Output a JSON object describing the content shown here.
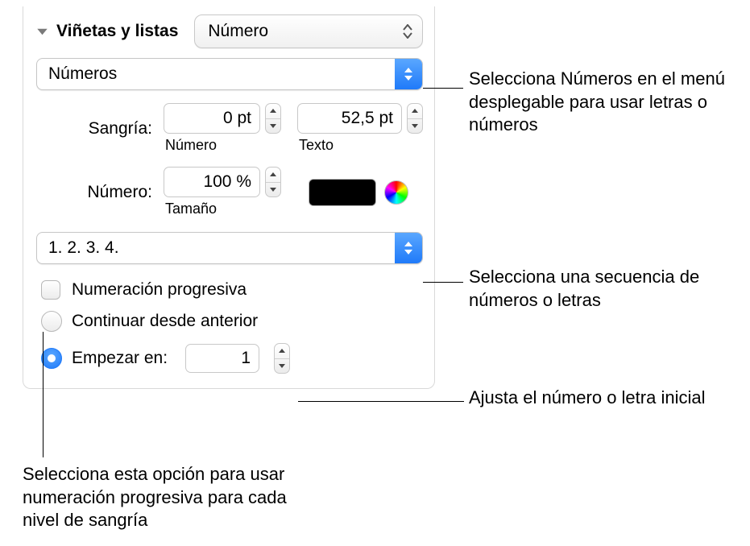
{
  "header": {
    "title": "Viñetas y listas",
    "type_value": "Número"
  },
  "numbers_popup": {
    "value": "Números"
  },
  "indent": {
    "label": "Sangría:",
    "number_value": "0 pt",
    "number_sublabel": "Número",
    "text_value": "52,5 pt",
    "text_sublabel": "Texto"
  },
  "number": {
    "label": "Número:",
    "size_value": "100 %",
    "size_sublabel": "Tamaño",
    "color": "#000000"
  },
  "sequence_popup": {
    "value": "1. 2. 3. 4."
  },
  "tiered": {
    "label": "Numeración progresiva"
  },
  "continue": {
    "label": "Continuar desde anterior"
  },
  "start": {
    "label": "Empezar en:",
    "value": "1"
  },
  "callouts": {
    "numbers": "Selecciona Números en el menú desplegable para usar letras o números",
    "sequence": "Selecciona una secuencia de números o letras",
    "start": "Ajusta el número o letra inicial",
    "tiered": "Selecciona esta opción para usar numeración progresiva para cada nivel de sangría"
  }
}
